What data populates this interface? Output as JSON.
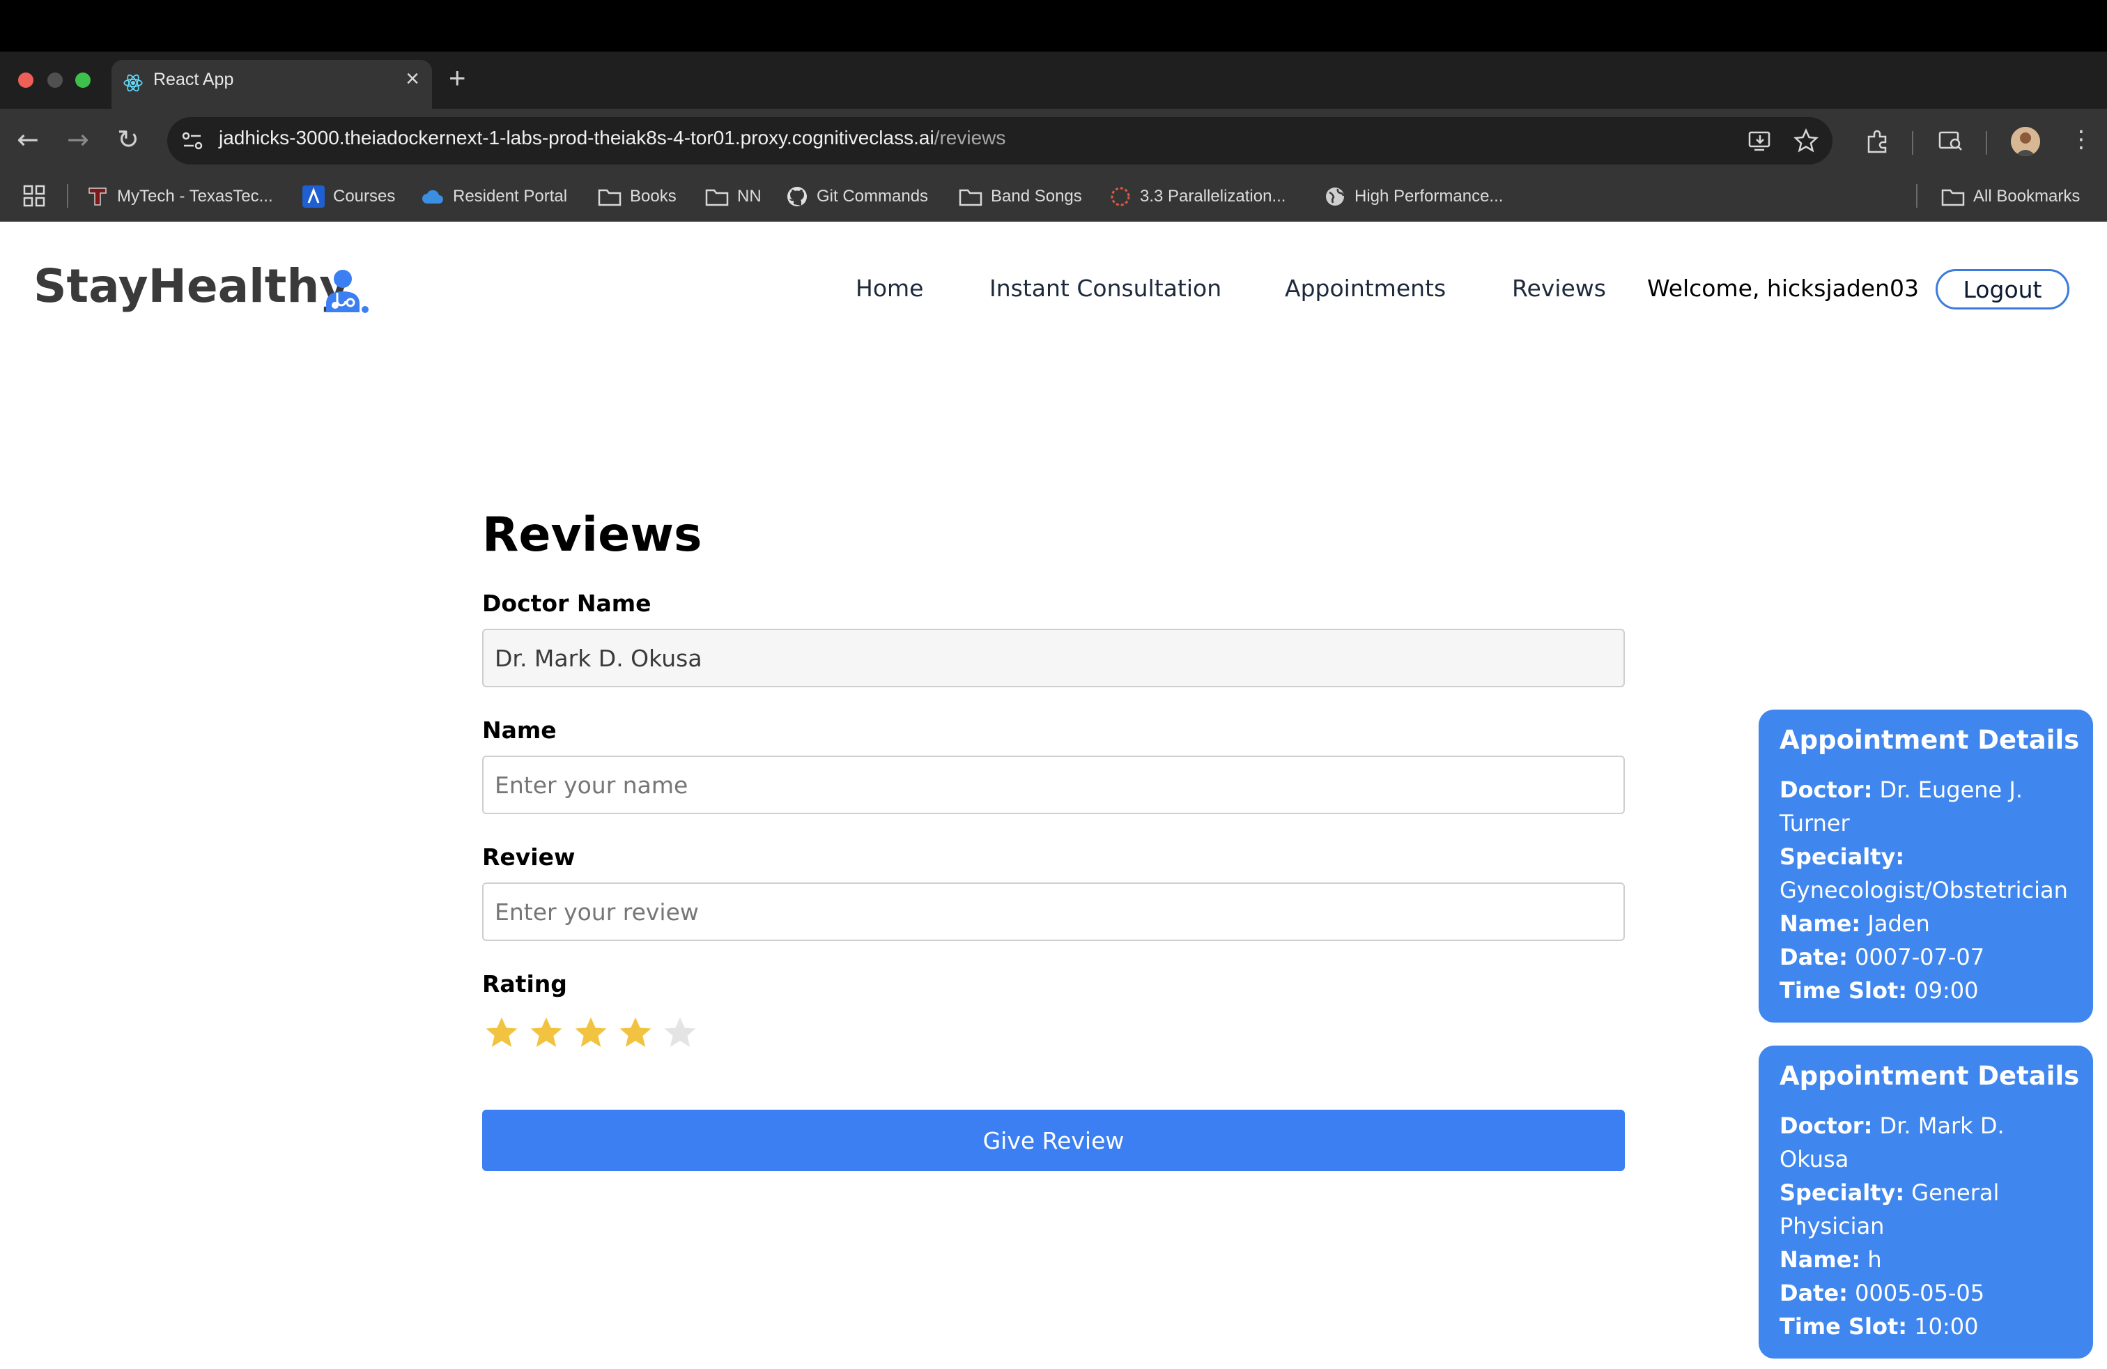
{
  "browser": {
    "tab_title": "React App",
    "new_tab_label": "+",
    "url_host": "jadhicks-3000.theiadockernext-1-labs-prod-theiak8s-4-tor01.proxy.cognitiveclass.ai",
    "url_path": "/reviews",
    "bookmarks": [
      {
        "label": "MyTech - TexasTec...",
        "icon": "texas-tech-icon"
      },
      {
        "label": "Courses",
        "icon": "courses-icon"
      },
      {
        "label": "Resident Portal",
        "icon": "cloud-icon"
      },
      {
        "label": "Books",
        "icon": "folder-icon"
      },
      {
        "label": "NN",
        "icon": "folder-icon"
      },
      {
        "label": "Git Commands",
        "icon": "github-icon"
      },
      {
        "label": "Band Songs",
        "icon": "folder-icon"
      },
      {
        "label": "3.3 Parallelization...",
        "icon": "spinner-icon"
      },
      {
        "label": "High Performance...",
        "icon": "globe-icon"
      }
    ],
    "all_bookmarks_label": "All Bookmarks"
  },
  "app": {
    "brand": "StayHealthy",
    "brand_icon": "doctor-icon",
    "nav": {
      "home": "Home",
      "instant_consultation": "Instant Consultation",
      "appointments": "Appointments",
      "reviews": "Reviews"
    },
    "welcome": "Welcome, hicksjaden03",
    "logout": "Logout"
  },
  "form": {
    "heading": "Reviews",
    "doctor_label": "Doctor Name",
    "doctor_value": "Dr. Mark D. Okusa",
    "name_label": "Name",
    "name_placeholder": "Enter your name",
    "review_label": "Review",
    "review_placeholder": "Enter your review",
    "rating_label": "Rating",
    "rating": 4,
    "rating_max": 5,
    "submit": "Give Review"
  },
  "appointments": [
    {
      "title": "Appointment Details",
      "doctor_label": "Doctor:",
      "doctor": "Dr. Eugene J. Turner",
      "specialty_label": "Specialty:",
      "specialty": "Gynecologist/Obstetrician",
      "name_label": "Name:",
      "name": "Jaden",
      "date_label": "Date:",
      "date": "0007-07-07",
      "time_label": "Time Slot:",
      "time": "09:00"
    },
    {
      "title": "Appointment Details",
      "doctor_label": "Doctor:",
      "doctor": "Dr. Mark D. Okusa",
      "specialty_label": "Specialty:",
      "specialty": "General Physician",
      "name_label": "Name:",
      "name": "h",
      "date_label": "Date:",
      "date": "0005-05-05",
      "time_label": "Time Slot:",
      "time": "10:00"
    }
  ],
  "colors": {
    "primary": "#3b7ff2",
    "card": "#3f86ee",
    "star_on": "#f2c341",
    "star_off": "#e4e4e4"
  }
}
